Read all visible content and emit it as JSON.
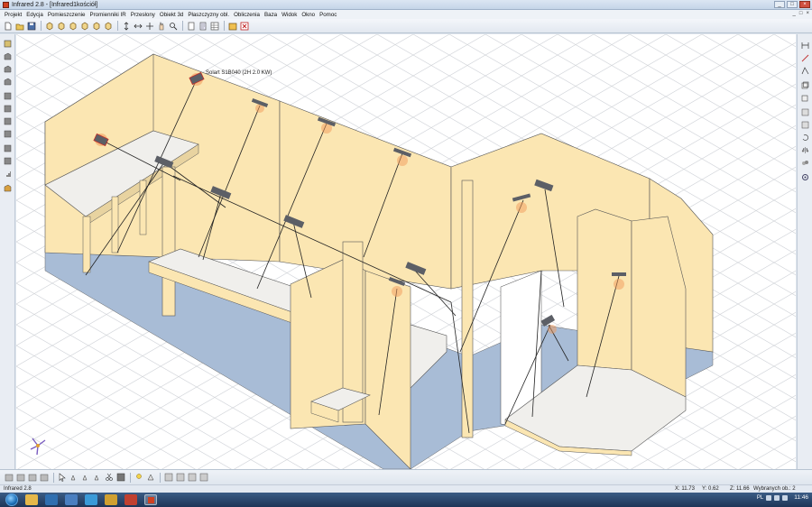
{
  "window": {
    "title": "Infrared 2.8 - [Infrared1kościół]",
    "controls": [
      "_",
      "□",
      "×"
    ]
  },
  "menu": [
    "Projekt",
    "Edycja",
    "Pomieszczenie",
    "Promienniki IR",
    "Przesłony",
    "Obiekt 3d",
    "Płaszczyzny obl.",
    "Obliczenia",
    "Baza",
    "Widok",
    "Okno",
    "Pomoc"
  ],
  "mdi_controls": [
    "_",
    "□",
    "×"
  ],
  "viewport": {
    "heater_label": "Solart S1B040 (2H 2.0 KW)",
    "colors": {
      "wall": "#fbe6b2",
      "floor": "#a8bcd6",
      "platform": "#f0efec",
      "grid": "#d2d5da",
      "heater_glow": "#f29a59",
      "heater_body": "#5c5f66"
    }
  },
  "status": {
    "app": "Infrared 2.8",
    "x": "X: 11.73",
    "y": "Y: 0.62",
    "z": "Z: 11.66",
    "selected": "Wybranych ob.: 2"
  },
  "taskbar": {
    "clock": "11:46"
  }
}
